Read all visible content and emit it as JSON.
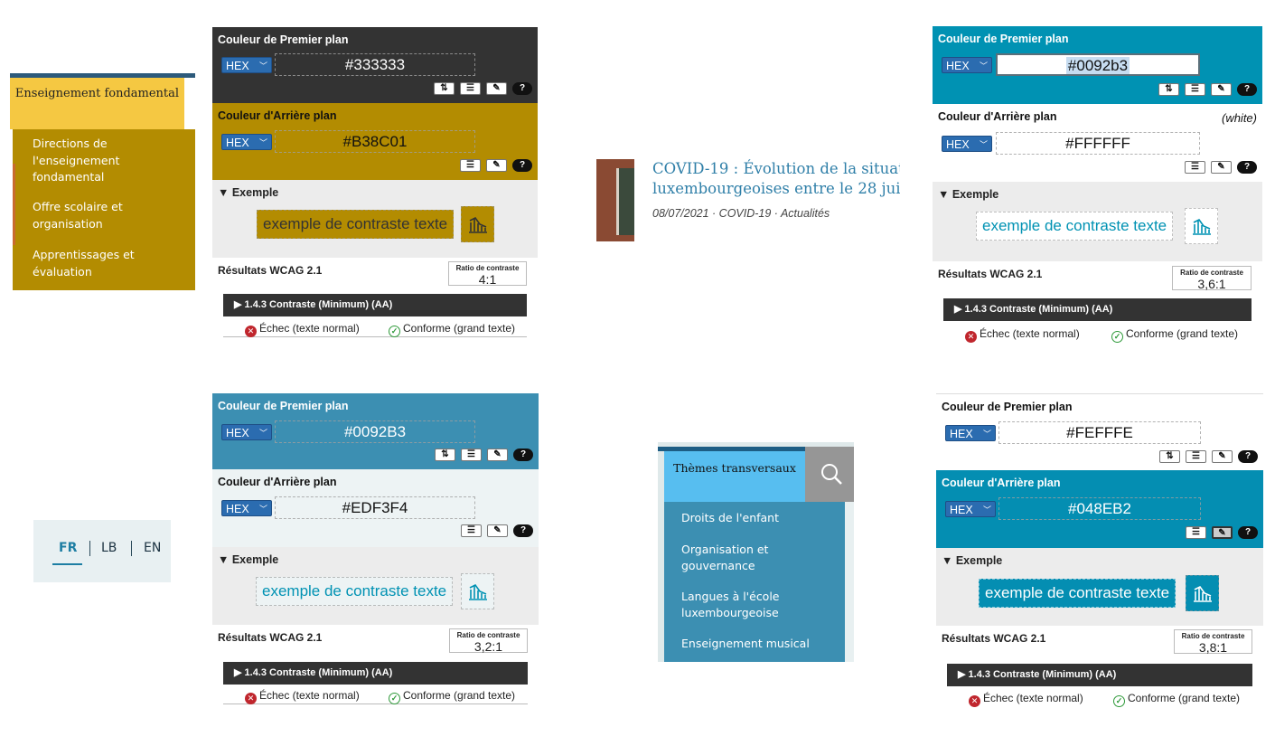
{
  "colors": {
    "blue": "#0092b3",
    "gold": "#b38c01",
    "dark": "#333333",
    "light": "#edf3f4"
  },
  "ens_menu": {
    "title": "Enseignement fondamental",
    "items": [
      "Directions de l'enseignement fondamental",
      "Offre scolaire et organisation",
      "Apprentissages et évaluation"
    ]
  },
  "news": {
    "title_line1": "COVID-19 : Évolution de la situat",
    "title_line2": "luxembourgeoises entre le 28 jui",
    "meta": "08/07/2021  · COVID-19  · Actualités"
  },
  "lang": {
    "items": [
      "FR",
      "LB",
      "EN"
    ]
  },
  "themes": {
    "title": "Thèmes transversaux",
    "items": [
      "Droits de l'enfant",
      "Organisation et gouvernance",
      "Langues à l'école luxembourgeoise",
      "Enseignement musical"
    ]
  },
  "common": {
    "fg_title": "Couleur de Premier plan",
    "bg_title": "Couleur d'Arrière plan",
    "format": "HEX",
    "example_title": "▼ Exemple",
    "example_text": "exemple de contraste texte",
    "results_title": "Résultats WCAG 2.1",
    "ratio_label": "Ratio de contraste",
    "criterion": "▶  1.4.3 Contraste (Minimum) (AA)",
    "fail": "Échec (texte normal)",
    "pass": "Conforme (grand texte)",
    "white_note": "(white)",
    "tool_swap": "⇅",
    "tool_adjust": "☰",
    "tool_picker": "✎",
    "tool_help": "?",
    "fail_icon": "✕",
    "pass_icon": "✓"
  },
  "panels": [
    {
      "fg": "#333333",
      "bg": "#B38C01",
      "ratio": "4:1"
    },
    {
      "fg": "#0092B3",
      "bg": "#EDF3F4",
      "ratio": "3,2:1"
    },
    {
      "fg": "#0092b3",
      "bg": "#FFFFFF",
      "ratio": "3,6:1"
    },
    {
      "fg": "#FEFFFE",
      "bg": "#048EB2",
      "ratio": "3,8:1"
    }
  ]
}
